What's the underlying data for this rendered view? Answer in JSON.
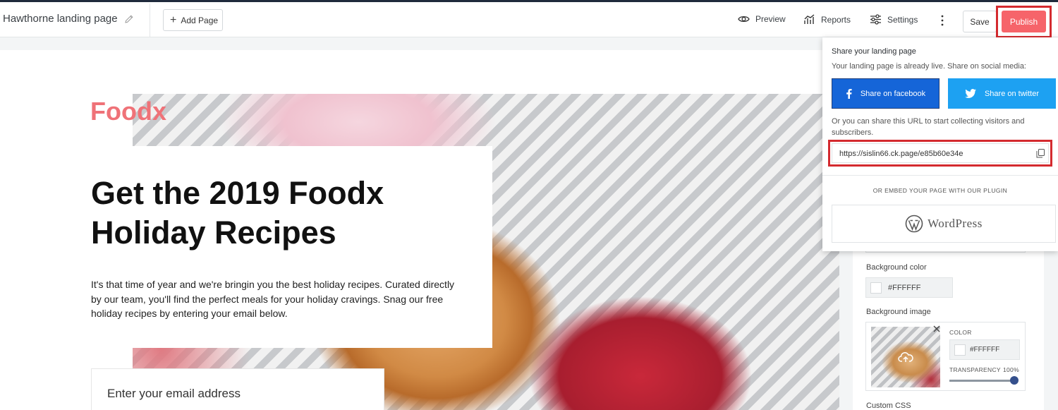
{
  "topbar": {
    "page_name": "Hawthorne landing page",
    "add_page": "Add Page",
    "preview": "Preview",
    "reports": "Reports",
    "settings": "Settings",
    "save": "Save",
    "publish": "Publish"
  },
  "hero": {
    "brand": "Foodx",
    "headline": "Get the 2019 Foodx Holiday Recipes",
    "intro": "It's that time of year and we're bringin you the best holiday recipes. Curated directly by our team, you'll find the perfect meals for your holiday cravings. Snag our free holiday recipes by entering your email below.",
    "email_placeholder": "Enter your email address"
  },
  "share": {
    "title": "Share your landing page",
    "subtitle": "Your landing page is already live. Share on social media:",
    "facebook": "Share on facebook",
    "twitter": "Share on twitter",
    "or_text": "Or you can share this URL to start collecting visitors and subscribers.",
    "url": "https://sislin66.ck.page/e85b60e34e",
    "embed_label": "OR EMBED YOUR PAGE WITH OUR PLUGIN",
    "wordpress": "WordPress"
  },
  "settings_panel": {
    "background_color_label": "Background color",
    "background_color": "#FFFFFF",
    "background_image_label": "Background image",
    "color_label": "COLOR",
    "image_color": "#FFFFFF",
    "transparency_label": "TRANSPARENCY",
    "transparency_value": "100%",
    "custom_css_label": "Custom CSS"
  },
  "colors": {
    "publish": "#f6646a",
    "highlight": "#d42a2f",
    "facebook": "#1565d8",
    "twitter": "#1da1f2",
    "brand": "#ef7278"
  },
  "icons": [
    "pencil-icon",
    "plus-icon",
    "eye-icon",
    "reports-icon",
    "sliders-icon",
    "kebab-icon",
    "facebook-icon",
    "twitter-icon",
    "copy-icon",
    "wordpress-icon",
    "close-icon",
    "upload-cloud-icon"
  ]
}
